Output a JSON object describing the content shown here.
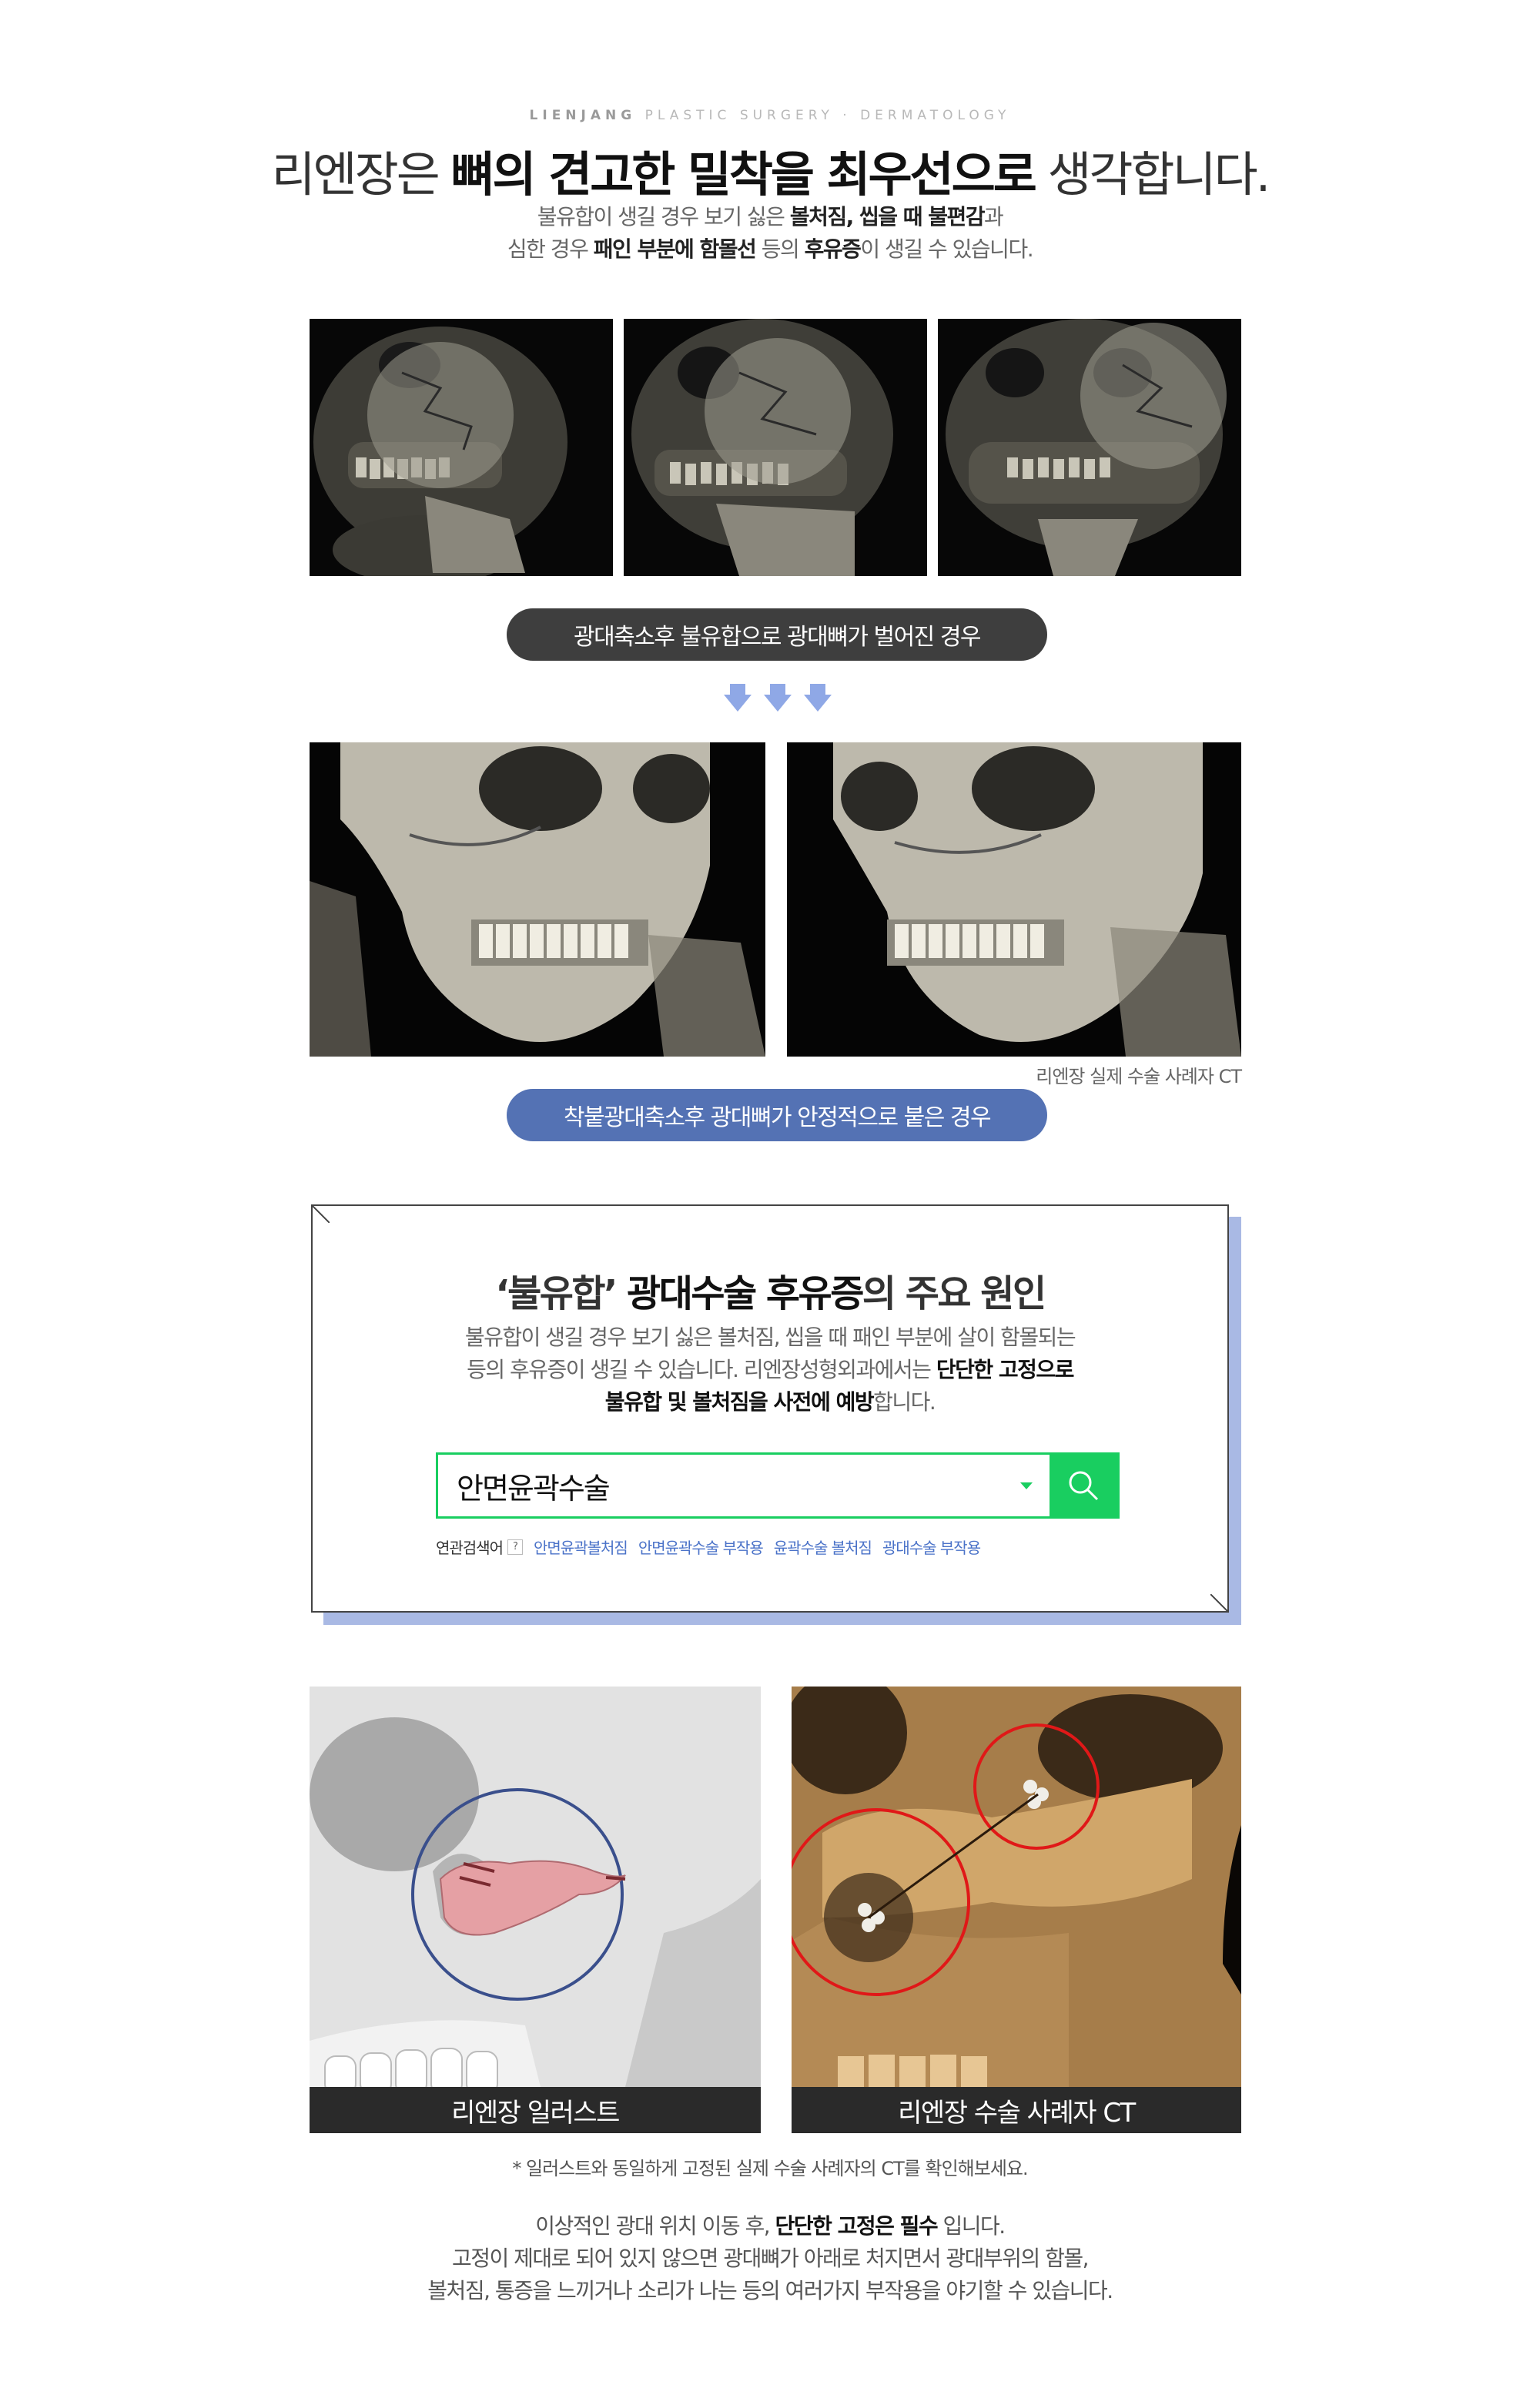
{
  "header": {
    "brand_bold": "LIENJANG",
    "brand_rest": "PLASTIC SURGERY · DERMATOLOGY",
    "headline_pre": "리엔장은 ",
    "headline_bold": "뼈의 견고한 밀착을 최우선으로",
    "headline_post": " 생각합니다.",
    "sub1_pre": "불유합이 생길 경우 보기 싫은 ",
    "sub1_bold": "볼처짐, 씹을 때 불편감",
    "sub1_post": "과",
    "sub2_pre": "심한 경우 ",
    "sub2_bold1": "패인 부분에 함몰선",
    "sub2_mid": " 등의 ",
    "sub2_bold2": "후유증",
    "sub2_post": "이 생길 수 있습니다."
  },
  "pill_bad": "광대축소후 불유합으로 광대뼈가 벌어진 경우",
  "ct_caption": "리엔장 실제 수술 사례자 CT",
  "pill_good": "착붙광대축소후 광대뼈가 안정적으로 붙은 경우",
  "box": {
    "title_pre": "‘불유합’ ",
    "title_bold": "광대수술 후유증",
    "title_post": "의 주요 원인",
    "line1": "불유합이 생길 경우 보기 싫은 볼처짐, 씹을 때 패인 부분에 살이 함몰되는",
    "line2_pre": "등의 후유증이 생길 수 있습니다. 리엔장성형외과에서는 ",
    "line2_bold": "단단한 고정으로",
    "line3_bold1": "불유합 및 볼처짐을 사전에 예방",
    "line3_post": "합니다.",
    "search_value": "안면윤곽수술",
    "related_label": "연관검색어",
    "related_help": "?",
    "related_keywords": [
      "안면윤곽볼처짐",
      "안면윤곽수술 부작용",
      "윤곽수술 볼처짐",
      "광대수술 부작용"
    ]
  },
  "illus_caption_left": "리엔장 일러스트",
  "illus_caption_right": "리엔장 수술 사례자 CT",
  "note": "* 일러스트와 동일하게 고정된 실제 수술 사례자의 CT를 확인해보세요.",
  "footer": {
    "line1_pre": "이상적인 광대 위치 이동 후, ",
    "line1_bold": "단단한 고정은 필수",
    "line1_post": " 입니다.",
    "line2": "고정이 제대로 되어 있지 않으면 광대뼈가 아래로 처지면서 광대부위의 함몰,",
    "line3": "볼처짐, 통증을 느끼거나 소리가 나는 등의 여러가지 부작용을 야기할 수 있습니다."
  },
  "icons": [
    "arrow-down-icon",
    "search-icon",
    "dropdown-caret-icon",
    "help-icon"
  ],
  "colors": {
    "pill_dark": "#3e3e3e",
    "pill_blue": "#5472b4",
    "search_green": "#19ce60",
    "box_shadow": "#a9b9e4",
    "keyword_blue": "#4a72c8",
    "circle_blue": "#3a4f8c",
    "circle_red": "#e01818"
  }
}
